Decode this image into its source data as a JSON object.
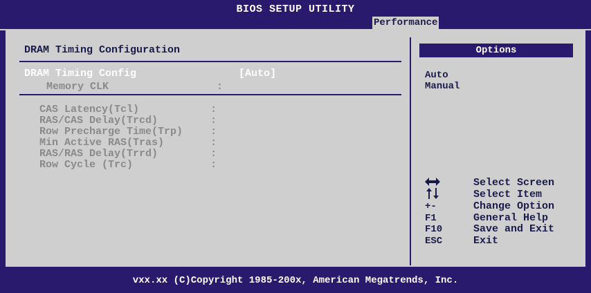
{
  "header": {
    "title": "BIOS SETUP UTILITY",
    "active_tab": "Performance"
  },
  "section": {
    "heading": "DRAM Timing Configuration"
  },
  "settings": {
    "dram_timing_config": {
      "label": "DRAM Timing Config",
      "value": "[Auto]"
    },
    "memory_clk": {
      "label": "Memory CLK",
      "sep": ":"
    }
  },
  "timings": [
    {
      "label": "CAS Latency(Tcl)",
      "sep": ":"
    },
    {
      "label": "RAS/CAS Delay(Trcd)",
      "sep": ":"
    },
    {
      "label": "Row Precharge Time(Trp)",
      "sep": ":"
    },
    {
      "label": "Min Active RAS(Tras)",
      "sep": ":"
    },
    {
      "label": "RAS/RAS Delay(Trrd)",
      "sep": ":"
    },
    {
      "label": "Row Cycle (Trc)",
      "sep": ":"
    }
  ],
  "options_panel": {
    "title": "Options",
    "items": [
      "Auto",
      "Manual"
    ]
  },
  "help": [
    {
      "key": "",
      "icon": "left-right-arrows-icon",
      "text": "Select Screen"
    },
    {
      "key": "",
      "icon": "up-down-arrows-icon",
      "text": "Select Item"
    },
    {
      "key": "+-",
      "text": "Change Option"
    },
    {
      "key": "F1",
      "text": "General Help"
    },
    {
      "key": "F10",
      "text": "Save and Exit"
    },
    {
      "key": "ESC",
      "text": "Exit"
    }
  ],
  "footer": {
    "copyright": "vxx.xx (C)Copyright 1985-200x, American Megatrends, Inc."
  },
  "colors": {
    "background": "#2a1a6e",
    "panel": "#cfcfcf",
    "selected_text": "#ffffff",
    "dim_text": "#8a8a8a",
    "text": "#1a1a4a"
  }
}
